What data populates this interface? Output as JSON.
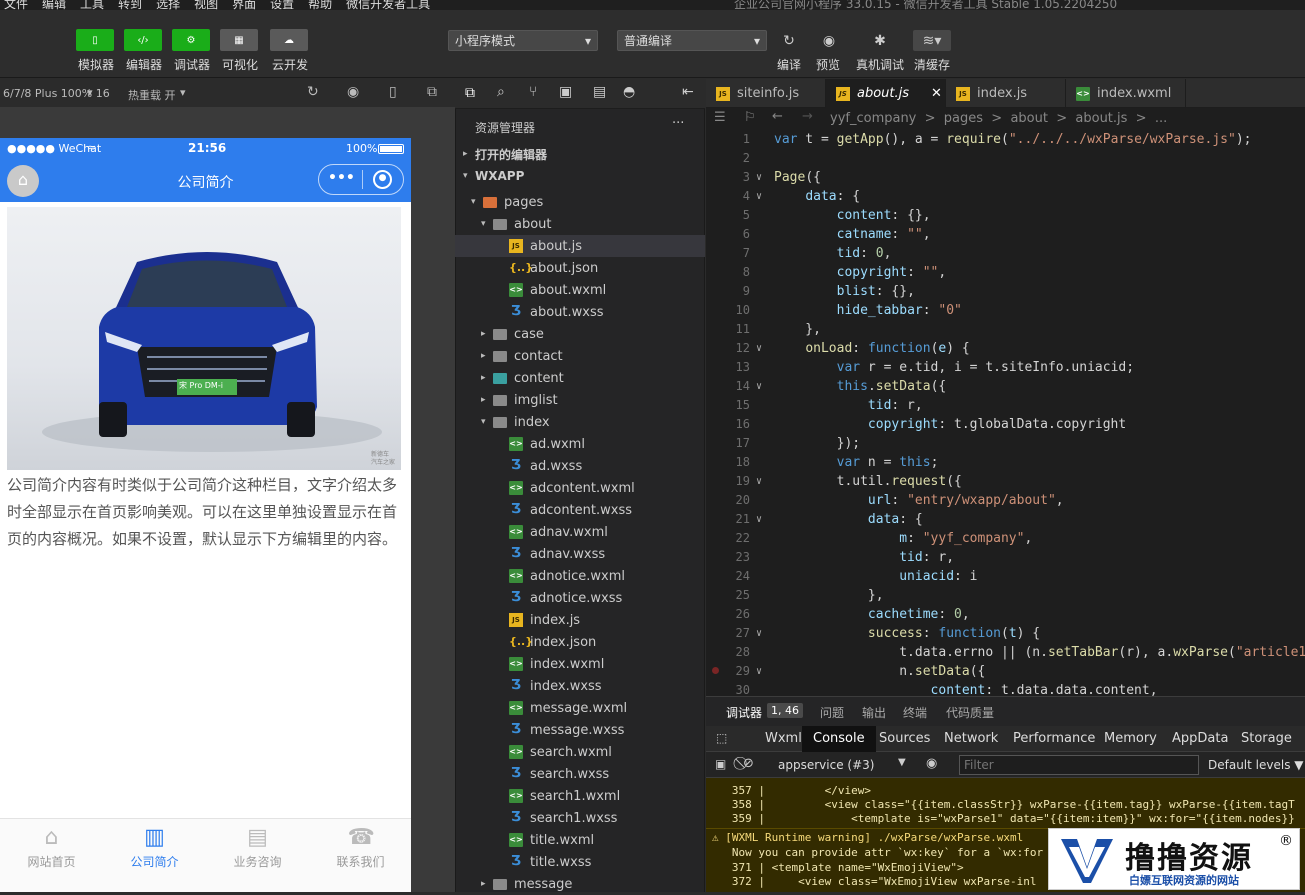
{
  "menubar": {
    "items": [
      "文件",
      "编辑",
      "工具",
      "转到",
      "选择",
      "视图",
      "界面",
      "设置",
      "帮助",
      "微信开发者工具"
    ],
    "window_title": "企业公司官网小程序 33.0.15 - 微信开发者工具 Stable 1.05.2204250"
  },
  "toolbar": {
    "simulator": "模拟器",
    "editor": "编辑器",
    "debugger": "调试器",
    "visual": "可视化",
    "cloud": "云开发",
    "mode_select": "小程序模式",
    "compile_select": "普通编译",
    "compile": "编译",
    "preview": "预览",
    "real_debug": "真机调试",
    "clear_cache": "清缓存"
  },
  "simbar": {
    "device": "6/7/8 Plus 100% 16",
    "hotreload": "热重载 开"
  },
  "phone": {
    "carrier": "●●●●● WeChat",
    "time": "21:56",
    "battery": "100%",
    "nav_title": "公司简介",
    "more": "•••",
    "intro": "公司简介内容有时类似于公司简介这种栏目，文字介绍太多时全部显示在首页影响美观。可以在这里单独设置显示在首页的内容概况。如果不设置，默认显示下方编辑里的内容。",
    "plate": "宋 Pro DM-i",
    "photo_credit": "新德车\n汽车之家",
    "tabs": [
      {
        "label": "网站首页",
        "active": false
      },
      {
        "label": "公司简介",
        "active": true
      },
      {
        "label": "业务咨询",
        "active": false
      },
      {
        "label": "联系我们",
        "active": false
      }
    ]
  },
  "explorer": {
    "title": "资源管理器",
    "more": "···",
    "open_editors": "打开的编辑器",
    "project": "WXAPP",
    "rows": [
      {
        "label": "pages",
        "icon": "folder",
        "arrow": "▾",
        "indent": 1
      },
      {
        "label": "about",
        "icon": "folder",
        "arrow": "▾",
        "indent": 2
      },
      {
        "label": "about.js",
        "icon": "js",
        "arrow": "",
        "indent": 3,
        "selected": true
      },
      {
        "label": "about.json",
        "icon": "json",
        "arrow": "",
        "indent": 3
      },
      {
        "label": "about.wxml",
        "icon": "wxml",
        "arrow": "",
        "indent": 3
      },
      {
        "label": "about.wxss",
        "icon": "wxss",
        "arrow": "",
        "indent": 3
      },
      {
        "label": "case",
        "icon": "folder",
        "arrow": "▸",
        "indent": 2
      },
      {
        "label": "contact",
        "icon": "folder",
        "arrow": "▸",
        "indent": 2
      },
      {
        "label": "content",
        "icon": "folder",
        "arrow": "▸",
        "indent": 2
      },
      {
        "label": "imglist",
        "icon": "folder",
        "arrow": "▸",
        "indent": 2
      },
      {
        "label": "index",
        "icon": "folder",
        "arrow": "▾",
        "indent": 2
      },
      {
        "label": "ad.wxml",
        "icon": "wxml",
        "arrow": "",
        "indent": 3
      },
      {
        "label": "ad.wxss",
        "icon": "wxss",
        "arrow": "",
        "indent": 3
      },
      {
        "label": "adcontent.wxml",
        "icon": "wxml",
        "arrow": "",
        "indent": 3
      },
      {
        "label": "adcontent.wxss",
        "icon": "wxss",
        "arrow": "",
        "indent": 3
      },
      {
        "label": "adnav.wxml",
        "icon": "wxml",
        "arrow": "",
        "indent": 3
      },
      {
        "label": "adnav.wxss",
        "icon": "wxss",
        "arrow": "",
        "indent": 3
      },
      {
        "label": "adnotice.wxml",
        "icon": "wxml",
        "arrow": "",
        "indent": 3
      },
      {
        "label": "adnotice.wxss",
        "icon": "wxss",
        "arrow": "",
        "indent": 3
      },
      {
        "label": "index.js",
        "icon": "js",
        "arrow": "",
        "indent": 3
      },
      {
        "label": "index.json",
        "icon": "json",
        "arrow": "",
        "indent": 3
      },
      {
        "label": "index.wxml",
        "icon": "wxml",
        "arrow": "",
        "indent": 3
      },
      {
        "label": "index.wxss",
        "icon": "wxss",
        "arrow": "",
        "indent": 3
      },
      {
        "label": "message.wxml",
        "icon": "wxml",
        "arrow": "",
        "indent": 3
      },
      {
        "label": "message.wxss",
        "icon": "wxss",
        "arrow": "",
        "indent": 3
      },
      {
        "label": "search.wxml",
        "icon": "wxml",
        "arrow": "",
        "indent": 3
      },
      {
        "label": "search.wxss",
        "icon": "wxss",
        "arrow": "",
        "indent": 3
      },
      {
        "label": "search1.wxml",
        "icon": "wxml",
        "arrow": "",
        "indent": 3
      },
      {
        "label": "search1.wxss",
        "icon": "wxss",
        "arrow": "",
        "indent": 3
      },
      {
        "label": "title.wxml",
        "icon": "wxml",
        "arrow": "",
        "indent": 3
      },
      {
        "label": "title.wxss",
        "icon": "wxss",
        "arrow": "",
        "indent": 3
      },
      {
        "label": "message",
        "icon": "folder",
        "arrow": "▸",
        "indent": 2
      }
    ]
  },
  "editor": {
    "tabs": [
      {
        "label": "siteinfo.js",
        "active": false,
        "icon": "js"
      },
      {
        "label": "about.js",
        "active": true,
        "icon": "js"
      },
      {
        "label": "index.js",
        "active": false,
        "icon": "js"
      },
      {
        "label": "index.wxml",
        "active": false,
        "icon": "wxml"
      }
    ],
    "breadcrumb": "yyf_company  >  pages  >  about  >  about.js  >  ...",
    "lines": [
      {
        "n": "1",
        "fold": "",
        "html": "<span class='k'>var</span> t = <span class='f'>getApp</span>(), a = <span class='f'>require</span>(<span class='s'>\"../../../wxParse/wxParse.js\"</span>);"
      },
      {
        "n": "2",
        "fold": "",
        "html": ""
      },
      {
        "n": "3",
        "fold": "∨",
        "html": "<span class='f'>Page</span>({"
      },
      {
        "n": "4",
        "fold": "∨",
        "html": "    <span class='p'>data</span>: {"
      },
      {
        "n": "5",
        "fold": "",
        "html": "        <span class='p'>content</span>: {},"
      },
      {
        "n": "6",
        "fold": "",
        "html": "        <span class='p'>catname</span>: <span class='s'>\"\"</span>,"
      },
      {
        "n": "7",
        "fold": "",
        "html": "        <span class='p'>tid</span>: <span class='n'>0</span>,"
      },
      {
        "n": "8",
        "fold": "",
        "html": "        <span class='p'>copyright</span>: <span class='s'>\"\"</span>,"
      },
      {
        "n": "9",
        "fold": "",
        "html": "        <span class='p'>blist</span>: {},"
      },
      {
        "n": "10",
        "fold": "",
        "html": "        <span class='p'>hide_tabbar</span>: <span class='s'>\"0\"</span>"
      },
      {
        "n": "11",
        "fold": "",
        "html": "    },"
      },
      {
        "n": "12",
        "fold": "∨",
        "html": "    <span class='f'>onLoad</span>: <span class='k'>function</span>(<span class='p'>e</span>) {"
      },
      {
        "n": "13",
        "fold": "",
        "html": "        <span class='k'>var</span> r = e.tid, i = t.siteInfo.uniacid;"
      },
      {
        "n": "14",
        "fold": "∨",
        "html": "        <span class='k'>this</span>.<span class='f'>setData</span>({"
      },
      {
        "n": "15",
        "fold": "",
        "html": "            <span class='p'>tid</span>: r,"
      },
      {
        "n": "16",
        "fold": "",
        "html": "            <span class='p'>copyright</span>: t.globalData.copyright"
      },
      {
        "n": "17",
        "fold": "",
        "html": "        });"
      },
      {
        "n": "18",
        "fold": "",
        "html": "        <span class='k'>var</span> n = <span class='k'>this</span>;"
      },
      {
        "n": "19",
        "fold": "∨",
        "html": "        t.util.<span class='f'>request</span>({"
      },
      {
        "n": "20",
        "fold": "",
        "html": "            <span class='p'>url</span>: <span class='s'>\"entry/wxapp/about\"</span>,"
      },
      {
        "n": "21",
        "fold": "∨",
        "html": "            <span class='p'>data</span>: {"
      },
      {
        "n": "22",
        "fold": "",
        "html": "                <span class='p'>m</span>: <span class='s'>\"yyf_company\"</span>,"
      },
      {
        "n": "23",
        "fold": "",
        "html": "                <span class='p'>tid</span>: r,"
      },
      {
        "n": "24",
        "fold": "",
        "html": "                <span class='p'>uniacid</span>: i"
      },
      {
        "n": "25",
        "fold": "",
        "html": "            },"
      },
      {
        "n": "26",
        "fold": "",
        "html": "            <span class='p'>cachetime</span>: <span class='n'>0</span>,"
      },
      {
        "n": "27",
        "fold": "∨",
        "html": "            <span class='f'>success</span>: <span class='k'>function</span>(<span class='p'>t</span>) {"
      },
      {
        "n": "28",
        "fold": "",
        "html": "                t.data.errno || (n.<span class='f'>setTabBar</span>(r), a.<span class='f'>wxParse</span>(<span class='s'>\"article1\"</span>"
      },
      {
        "n": "29",
        "fold": "∨",
        "html": "                n.<span class='f'>setData</span>({"
      },
      {
        "n": "30",
        "fold": "",
        "html": "                    <span class='p'>content</span>: t.data.data.content,"
      }
    ]
  },
  "debugger": {
    "tabs": [
      "调试器",
      "问题",
      "输出",
      "终端",
      "代码质量"
    ],
    "badge": "1, 46",
    "devtabs": [
      "Wxml",
      "Console",
      "Sources",
      "Network",
      "Performance",
      "Memory",
      "AppData",
      "Storage"
    ],
    "context": "appservice (#3)",
    "filter_placeholder": "Filter",
    "levels": "Default levels ▼",
    "console_lines": [
      "   357 |         </view>",
      "   358 |         <view class=\"{{item.classStr}} wxParse-{{item.tag}} wxParse-{{item.tagT",
      "   359 |             <template is=\"wxParse1\" data=\"{{item:item}}\" wx:for=\"{{item.nodes}}",
      "⚠ [WXML Runtime warning] ./wxParse/wxParse.wxml",
      "   Now you can provide attr `wx:key` for a `wx:for",
      "   371 | <template name=\"WxEmojiView\">",
      "   372 |     <view class=\"WxEmojiView wxParse-inl"
    ]
  },
  "watermark": {
    "title": "撸撸资源",
    "sub": "白嫖互联网资源的网站",
    "reg": "®"
  },
  "colors": {
    "accent_green": "#1aad19",
    "nav_blue": "#2e7ded",
    "editor_bg": "#1e1e1e"
  }
}
